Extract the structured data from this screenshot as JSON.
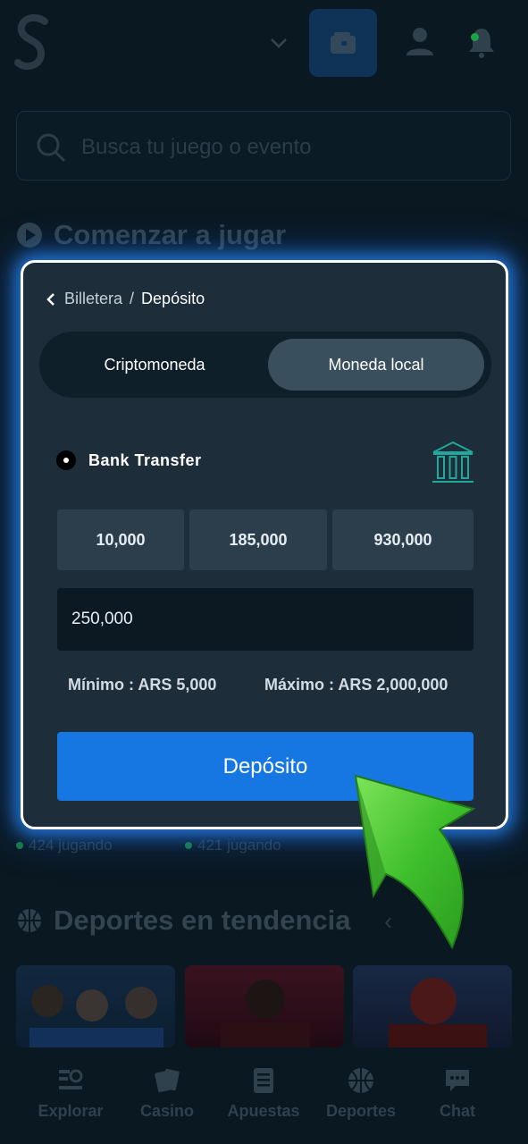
{
  "header": {
    "logo_icon": "s-logo-icon",
    "icons": [
      "chevron-down-icon",
      "wallet-icon",
      "user-icon",
      "bell-icon"
    ]
  },
  "search": {
    "placeholder": "Busca tu juego o evento"
  },
  "sections": {
    "start_playing": "Comenzar a jugar",
    "trending_sports": "Deportes en tendencia"
  },
  "playing_counts": [
    "424 jugando",
    "421 jugando"
  ],
  "bottom_nav": [
    {
      "label": "Explorar",
      "icon": "explore-icon"
    },
    {
      "label": "Casino",
      "icon": "cards-icon"
    },
    {
      "label": "Apuestas",
      "icon": "betslip-icon"
    },
    {
      "label": "Deportes",
      "icon": "basketball-icon"
    },
    {
      "label": "Chat",
      "icon": "chat-icon"
    }
  ],
  "modal": {
    "breadcrumb": {
      "parent": "Billetera",
      "separator": "/",
      "current": "Depósito"
    },
    "tabs": [
      {
        "label": "Criptomoneda",
        "active": false
      },
      {
        "label": "Moneda local",
        "active": true
      }
    ],
    "method": {
      "label": "Bank Transfer",
      "icon": "bank-icon"
    },
    "quick_amounts": [
      "10,000",
      "185,000",
      "930,000"
    ],
    "amount_value": "250,000",
    "min_label": "Mínimo : ARS 5,000",
    "max_label": "Máximo : ARS 2,000,000",
    "deposit_button": "Depósito"
  },
  "colors": {
    "accent": "#1677e3",
    "modal_bg": "#1d2d3a",
    "glow": "#298cff",
    "arrow": "#4cd13f"
  }
}
